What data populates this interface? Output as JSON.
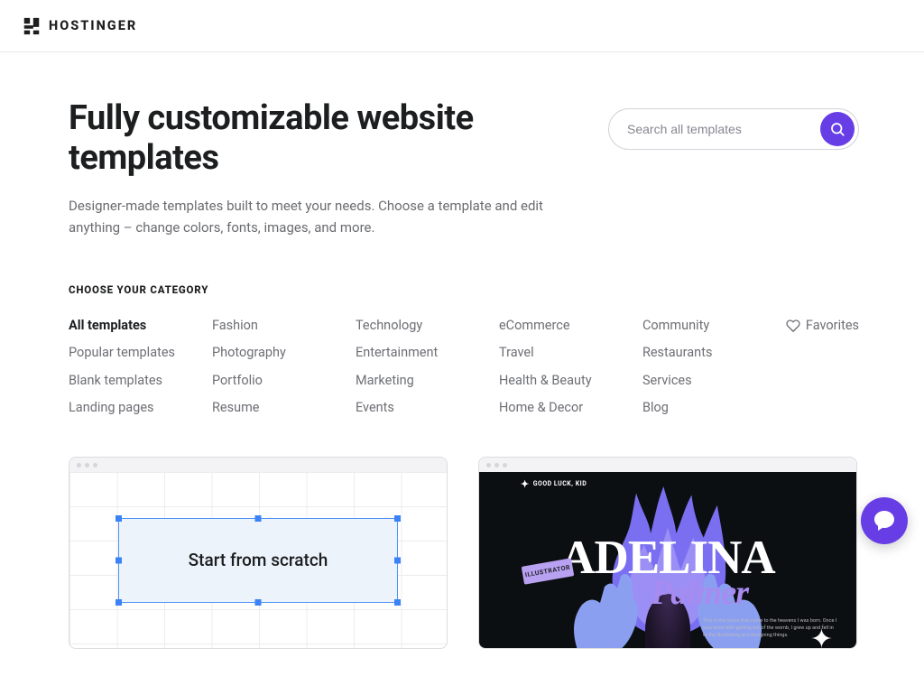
{
  "brand": {
    "name": "HOSTINGER"
  },
  "hero": {
    "title": "Fully customizable website templates",
    "subtitle": "Designer-made templates built to meet your needs. Choose a template and edit anything – change colors, fonts, images, and more."
  },
  "search": {
    "placeholder": "Search all templates"
  },
  "categories": {
    "label": "CHOOSE YOUR CATEGORY",
    "favorites": "Favorites",
    "cols": [
      [
        "All templates",
        "Popular templates",
        "Blank templates",
        "Landing pages"
      ],
      [
        "Fashion",
        "Photography",
        "Portfolio",
        "Resume"
      ],
      [
        "Technology",
        "Entertainment",
        "Marketing",
        "Events"
      ],
      [
        "eCommerce",
        "Travel",
        "Health & Beauty",
        "Home & Decor"
      ],
      [
        "Community",
        "Restaurants",
        "Services",
        "Blog"
      ]
    ],
    "active": "All templates"
  },
  "templates": {
    "scratch": {
      "label": "Start from scratch"
    },
    "adelina": {
      "tag": "GOOD LUCK, KID",
      "badge": "ILLUSTRATOR",
      "line1": "ADELINA",
      "line2": "Palmer",
      "desc": "This is the name that came to the heavens I was born. Once I was done with getting out of the womb, I grew up and fell in to the illustrating and designing things."
    }
  },
  "colors": {
    "accent": "#673de6"
  }
}
